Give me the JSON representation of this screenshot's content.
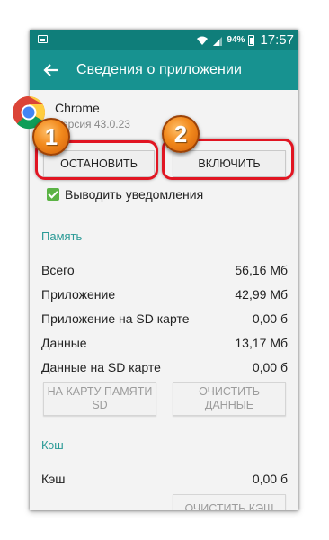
{
  "status_bar": {
    "battery_percent": "94%",
    "time": "17:57",
    "colors": {
      "status_bar": "#0f7e7a",
      "action_bar": "#179290"
    }
  },
  "header": {
    "title": "Сведения о приложении"
  },
  "app": {
    "name": "Chrome",
    "version": "Версия 43.0.23"
  },
  "buttons": {
    "stop": "ОСТАНОВИТЬ",
    "enable": "ВКЛЮЧИТЬ",
    "move_to_sd": "НА КАРТУ ПАМЯТИ SD",
    "clear_data": "ОЧИСТИТЬ ДАННЫЕ",
    "clear_cache": "ОЧИСТИТЬ КЭШ"
  },
  "annotations": {
    "badge_1": "1",
    "badge_2": "2",
    "highlight_color": "#e11522"
  },
  "notifications": {
    "label": "Выводить уведомления",
    "checked": true
  },
  "memory": {
    "heading": "Память",
    "rows": [
      {
        "label": "Всего",
        "value": "56,16 Мб"
      },
      {
        "label": "Приложение",
        "value": "42,99 Мб"
      },
      {
        "label": "Приложение на SD карте",
        "value": "0,00 б"
      },
      {
        "label": "Данные",
        "value": "13,17 Мб"
      },
      {
        "label": "Данные на SD карте",
        "value": "0,00 б"
      }
    ]
  },
  "cache": {
    "heading": "Кэш",
    "rows": [
      {
        "label": "Кэш",
        "value": "0,00 б"
      }
    ]
  }
}
